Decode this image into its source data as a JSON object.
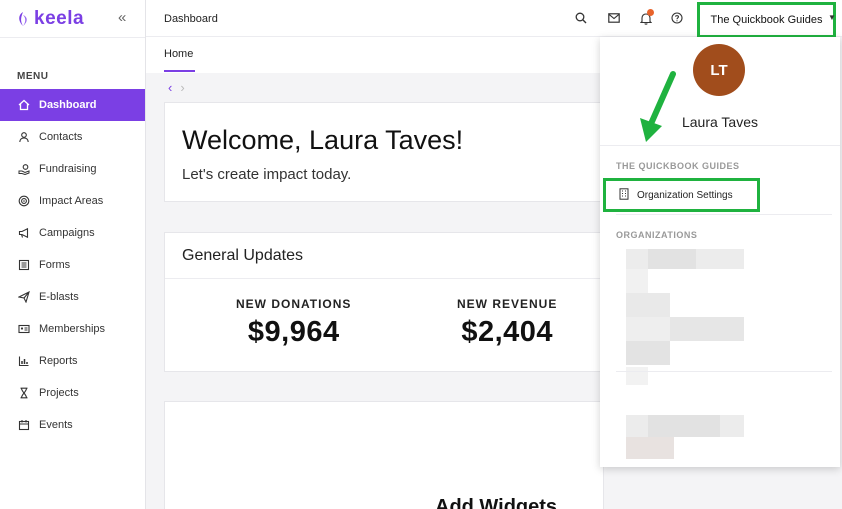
{
  "app": {
    "logo_text": "keela",
    "collapse_icon": "double-chevron-left-icon"
  },
  "sidebar": {
    "menu_label": "MENU",
    "items": [
      {
        "label": "Dashboard",
        "icon": "home-icon",
        "active": true
      },
      {
        "label": "Contacts",
        "icon": "person-icon"
      },
      {
        "label": "Fundraising",
        "icon": "hand-coin-icon"
      },
      {
        "label": "Impact Areas",
        "icon": "target-icon"
      },
      {
        "label": "Campaigns",
        "icon": "megaphone-icon"
      },
      {
        "label": "Forms",
        "icon": "form-icon"
      },
      {
        "label": "E-blasts",
        "icon": "send-icon"
      },
      {
        "label": "Memberships",
        "icon": "id-card-icon"
      },
      {
        "label": "Reports",
        "icon": "bar-chart-icon"
      },
      {
        "label": "Projects",
        "icon": "hourglass-icon"
      },
      {
        "label": "Events",
        "icon": "calendar-icon"
      }
    ]
  },
  "header": {
    "title": "Dashboard",
    "org_button": "The Quickbook Guides"
  },
  "tabs": {
    "home": "Home"
  },
  "welcome": {
    "heading": "Welcome, Laura Taves!",
    "subtitle": "Let's create impact today."
  },
  "updates": {
    "title": "General Updates",
    "stats": [
      {
        "label": "NEW DONATIONS",
        "value": "$9,964"
      },
      {
        "label": "NEW REVENUE",
        "value": "$2,404"
      }
    ]
  },
  "widgets": {
    "title": "Add Widgets"
  },
  "dropdown": {
    "initials": "LT",
    "user_name": "Laura Taves",
    "org_section": "THE QUICKBOOK GUIDES",
    "org_settings": "Organization Settings",
    "orgs_section": "ORGANIZATIONS"
  },
  "colors": {
    "accent": "#7b3fe4",
    "highlight": "#1fb23f",
    "avatar": "#a14d1c",
    "notification": "#e8632b"
  }
}
